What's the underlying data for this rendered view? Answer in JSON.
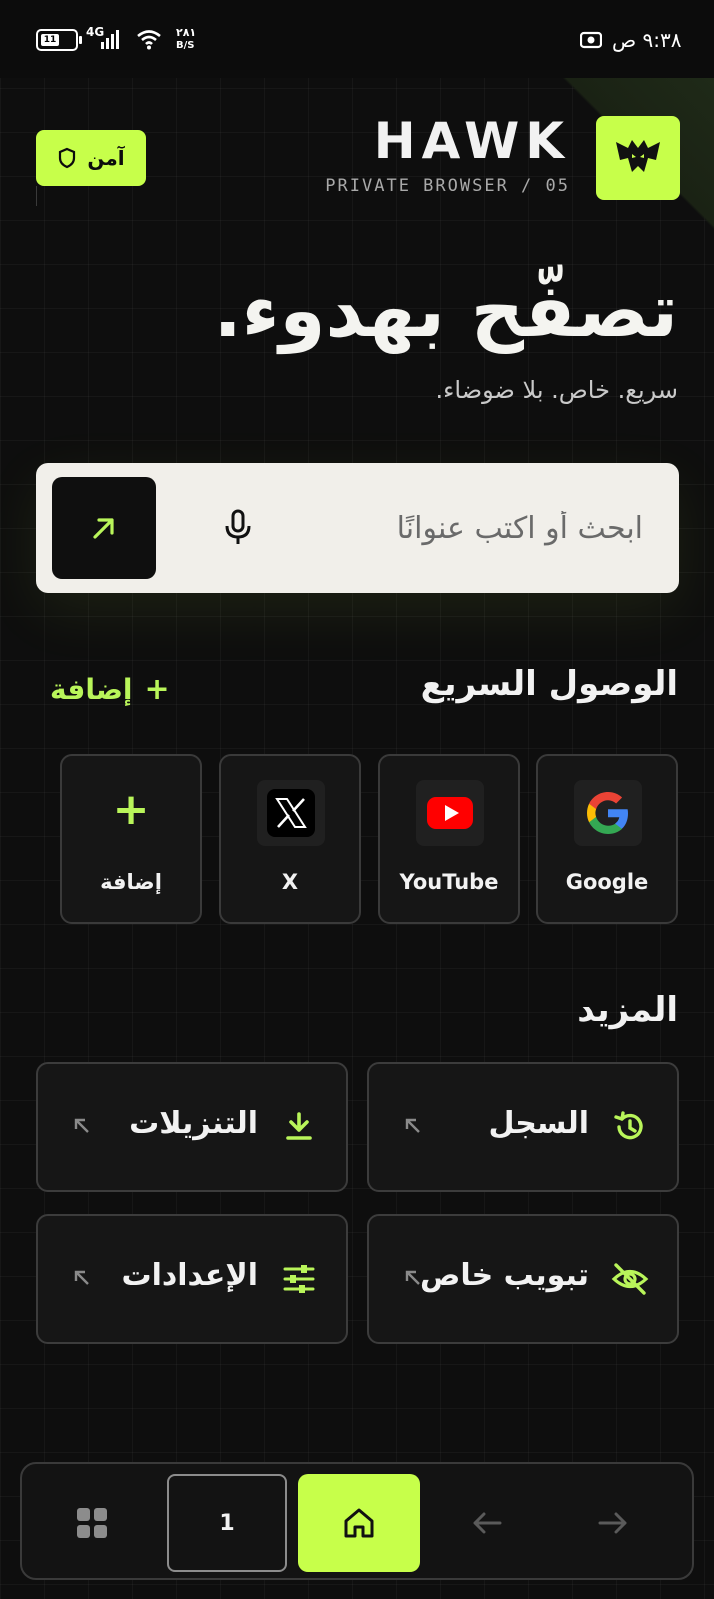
{
  "status_bar": {
    "time": "٩:٣٨ ص",
    "network": "4G",
    "speed_value": "٢٨١",
    "speed_unit": "B/S",
    "battery_level": "11"
  },
  "header": {
    "secure_label": "آمن",
    "brand_name": "HAWK",
    "brand_subtitle": "PRIVATE BROWSER / 05",
    "logo_icon": "hawk-logo-icon"
  },
  "hero": {
    "title": "تصفّح بهدوء.",
    "subtitle": "سريع. خاص. بلا ضوضاء."
  },
  "search": {
    "placeholder": "ابحث أو اكتب عنوانًا",
    "go_icon": "arrow-up-right-icon",
    "mic_icon": "microphone-icon"
  },
  "quick_access": {
    "title": "الوصول السريع",
    "add_label": "إضافة",
    "tiles": [
      {
        "label": "Google",
        "icon": "google-icon"
      },
      {
        "label": "YouTube",
        "icon": "youtube-icon"
      },
      {
        "label": "X",
        "icon": "x-icon"
      },
      {
        "label": "إضافة",
        "icon": "plus-icon"
      }
    ]
  },
  "more": {
    "title": "المزيد",
    "items": [
      {
        "label": "السجل",
        "icon": "history-icon"
      },
      {
        "label": "التنزيلات",
        "icon": "download-icon"
      },
      {
        "label": "تبويب خاص",
        "icon": "eye-off-icon"
      },
      {
        "label": "الإعدادات",
        "icon": "sliders-icon"
      }
    ]
  },
  "bottom_nav": {
    "tab_count": "1",
    "home_icon": "home-icon",
    "back_icon": "arrow-left-icon",
    "forward_icon": "arrow-right-icon",
    "grid_icon": "grid-icon"
  },
  "colors": {
    "accent": "#c7ff4a",
    "background": "#0e0e0e",
    "search_bg": "#f1efea"
  }
}
